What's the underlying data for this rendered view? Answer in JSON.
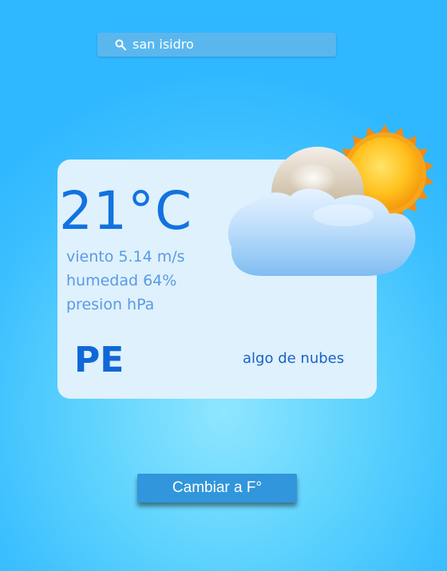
{
  "search": {
    "value": "san isidro",
    "icon": "search-icon"
  },
  "weather": {
    "temperature": "21°C",
    "wind": "viento 5.14 m/s",
    "humidity": "humedad 64%",
    "pressure": "presion hPa",
    "country": "PE",
    "description": "algo de nubes",
    "icon": "partly-cloudy-icon"
  },
  "actions": {
    "toggle_unit_label": "Cambiar a F°"
  },
  "colors": {
    "background": "#3cbfff",
    "card": "#dff1fc",
    "temperature": "#1372df",
    "button": "#3196db"
  }
}
